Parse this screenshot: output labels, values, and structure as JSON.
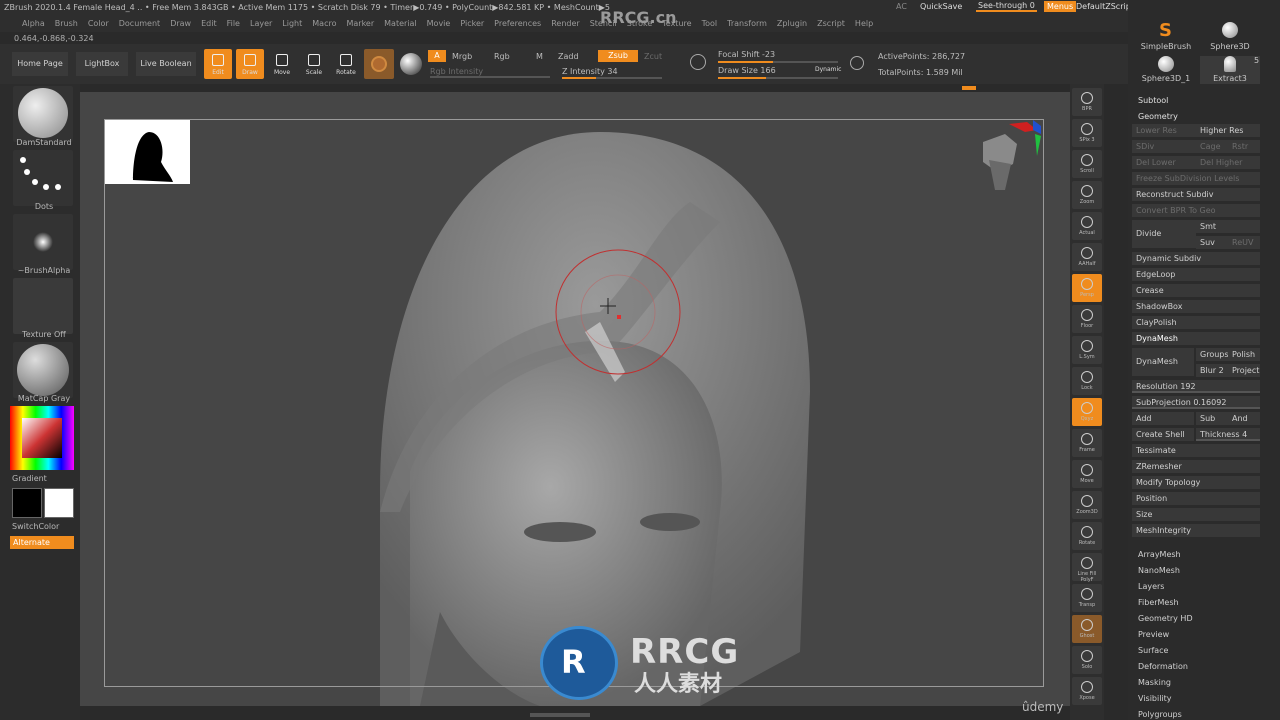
{
  "titlebar": {
    "text": "ZBrush 2020.1.4   Female Head_4   .. • Free Mem 3.843GB • Active Mem 1175 • Scratch Disk 79 • Timer▶0.749 • PolyCount▶842.581 KP • MeshCount▶5",
    "right_ac": "AC",
    "quicksave": "QuickSave",
    "seethrough": "See-through  0",
    "menus": "Menus",
    "zscript": "DefaultZScript"
  },
  "menubar": [
    "Alpha",
    "Brush",
    "Color",
    "Document",
    "Draw",
    "Edit",
    "File",
    "Layer",
    "Light",
    "Macro",
    "Marker",
    "Material",
    "Movie",
    "Picker",
    "Preferences",
    "Render",
    "Stencil",
    "Stroke",
    "Texture",
    "Tool",
    "Transform",
    "Zplugin",
    "Zscript",
    "Help"
  ],
  "coords": "0.464,-0.868,-0.324",
  "toolbar": {
    "home": "Home Page",
    "lightbox": "LightBox",
    "liveboolean": "Live Boolean",
    "edit": "Edit",
    "draw": "Draw",
    "move": "Move",
    "scale": "Scale",
    "rotate": "Rotate",
    "a": "A",
    "mrgb": "Mrgb",
    "rgb": "Rgb",
    "m": "M",
    "zadd": "Zadd",
    "zsub": "Zsub",
    "zcut": "Zcut",
    "rgb_intensity": "Rgb Intensity",
    "z_intensity": "Z Intensity 34",
    "focal_shift": "Focal Shift -23",
    "draw_size": "Draw Size 166",
    "dynamic": "Dynamic",
    "active_points": "ActivePoints: 286,727",
    "total_points": "TotalPoints: 1.589 Mil",
    "z_intensity_value": 0.34,
    "draw_size_value": 0.4
  },
  "leftshelf": {
    "brush": "DamStandard",
    "stroke": "Dots",
    "alpha": "~BrushAlpha",
    "texture": "Texture Off",
    "material": "MatCap Gray",
    "gradient": "Gradient",
    "switchcolor": "SwitchColor",
    "alternate": "Alternate"
  },
  "rightshelf": [
    "BPR",
    "SPix 3",
    "Scroll",
    "Zoom",
    "Actual",
    "AAHalf",
    "Persp",
    "Floor",
    "L.Sym",
    "Lock",
    "Qxyz",
    "Frame",
    "Move",
    "Zoom3D",
    "Rotate",
    "Line Fill PolyF",
    "Transp",
    "Ghost",
    "Solo",
    "Xpose"
  ],
  "rightpanel": {
    "brushes": [
      "SimpleBrush",
      "Sphere3D",
      "Sphere3D_1",
      "Extract3"
    ],
    "extract_count": "5",
    "subtool": "Subtool",
    "geometry": "Geometry",
    "lower_res": "Lower Res",
    "higher_res": "Higher Res",
    "sdiv": "SDiv",
    "cage": "Cage",
    "rstr": "Rstr",
    "del_lower": "Del Lower",
    "del_higher": "Del Higher",
    "freeze": "Freeze SubDivision Levels",
    "reconstruct": "Reconstruct Subdiv",
    "convert_bpr": "Convert BPR To Geo",
    "divide": "Divide",
    "smt": "Smt",
    "suv": "Suv",
    "reuv": "ReUV",
    "dynamic_subdiv": "Dynamic Subdiv",
    "edgeloop": "EdgeLoop",
    "crease": "Crease",
    "shadowbox": "ShadowBox",
    "claypolish": "ClayPolish",
    "dynamesh_header": "DynaMesh",
    "dynamesh_btn": "DynaMesh",
    "groups": "Groups",
    "polish": "Polish",
    "blur": "Blur 2",
    "project": "Project",
    "resolution": "Resolution 192",
    "subprojection": "SubProjection 0.16092",
    "add": "Add",
    "sub": "Sub",
    "and": "And",
    "create_shell": "Create Shell",
    "thickness": "Thickness 4",
    "tessimate": "Tessimate",
    "zremesher": "ZRemesher",
    "modify_topology": "Modify Topology",
    "position": "Position",
    "size": "Size",
    "meshintegrity": "MeshIntegrity",
    "sections": [
      "ArrayMesh",
      "NanoMesh",
      "Layers",
      "FiberMesh",
      "Geometry HD",
      "Preview",
      "Surface",
      "Deformation",
      "Masking",
      "Visibility",
      "Polygroups"
    ]
  },
  "watermark": {
    "brand": "RRCG",
    "sub": "人人素材",
    "udemy": "ûdemy",
    "top": "RRCG.cn"
  },
  "colors": {
    "accent": "#f08c1e",
    "bg": "#2a2a2a",
    "viewport": "#464646"
  }
}
